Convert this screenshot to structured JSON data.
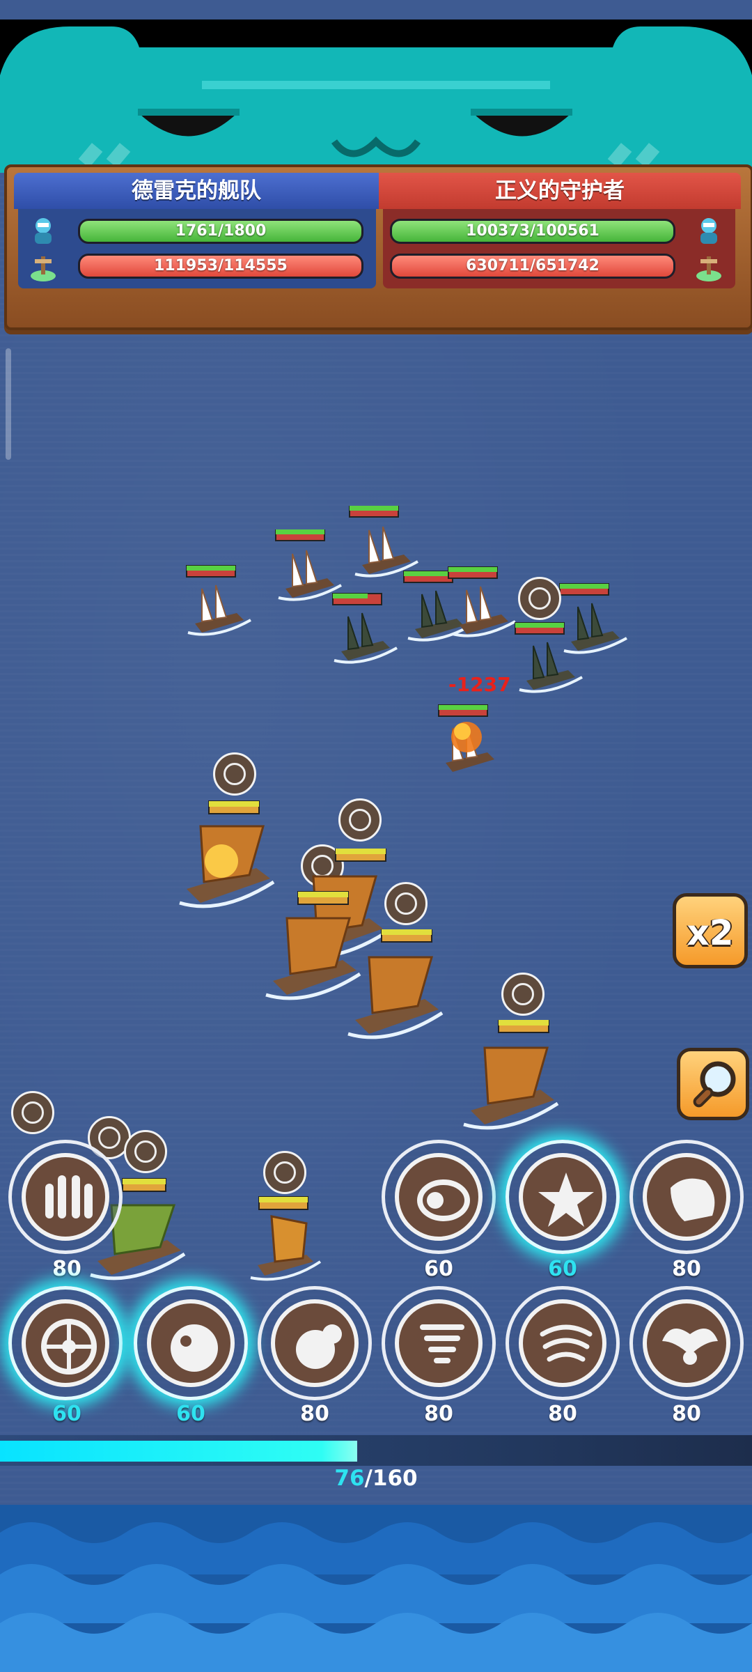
{
  "hud": {
    "left_team": {
      "name": "德雷克的舰队",
      "crew_hp": "1761/1800",
      "ship_hp": "111953/114555"
    },
    "right_team": {
      "name": "正义的守护者",
      "crew_hp": "100373/100561",
      "ship_hp": "630711/651742"
    }
  },
  "controls": {
    "speed_label": "x2",
    "zoom_icon": "magnifier-icon"
  },
  "battle": {
    "damage_popup": "-1237"
  },
  "skills": [
    {
      "cost": "80",
      "icon": "rocket-volley-icon",
      "active": false
    },
    {
      "cost": "60",
      "icon": "cannonball-icon",
      "active": false
    },
    {
      "cost": "60",
      "icon": "spiky-burst-icon",
      "active": true
    },
    {
      "cost": "80",
      "icon": "fist-icon",
      "active": false
    },
    {
      "cost": "60",
      "icon": "shield-wheel-icon",
      "active": true
    },
    {
      "cost": "60",
      "icon": "orb-icon",
      "active": true
    },
    {
      "cost": "80",
      "icon": "boulder-icon",
      "active": false
    },
    {
      "cost": "80",
      "icon": "tornado-icon",
      "active": false
    },
    {
      "cost": "80",
      "icon": "storm-icon",
      "active": false
    },
    {
      "cost": "80",
      "icon": "winged-icon",
      "active": false
    }
  ],
  "energy": {
    "current": "76",
    "max": "/160",
    "fraction": 0.475
  },
  "colors": {
    "sea": "#3e5b92",
    "energy": "#2ee2f0",
    "ally": "#2f4ea8",
    "enemy": "#c23b2f"
  }
}
